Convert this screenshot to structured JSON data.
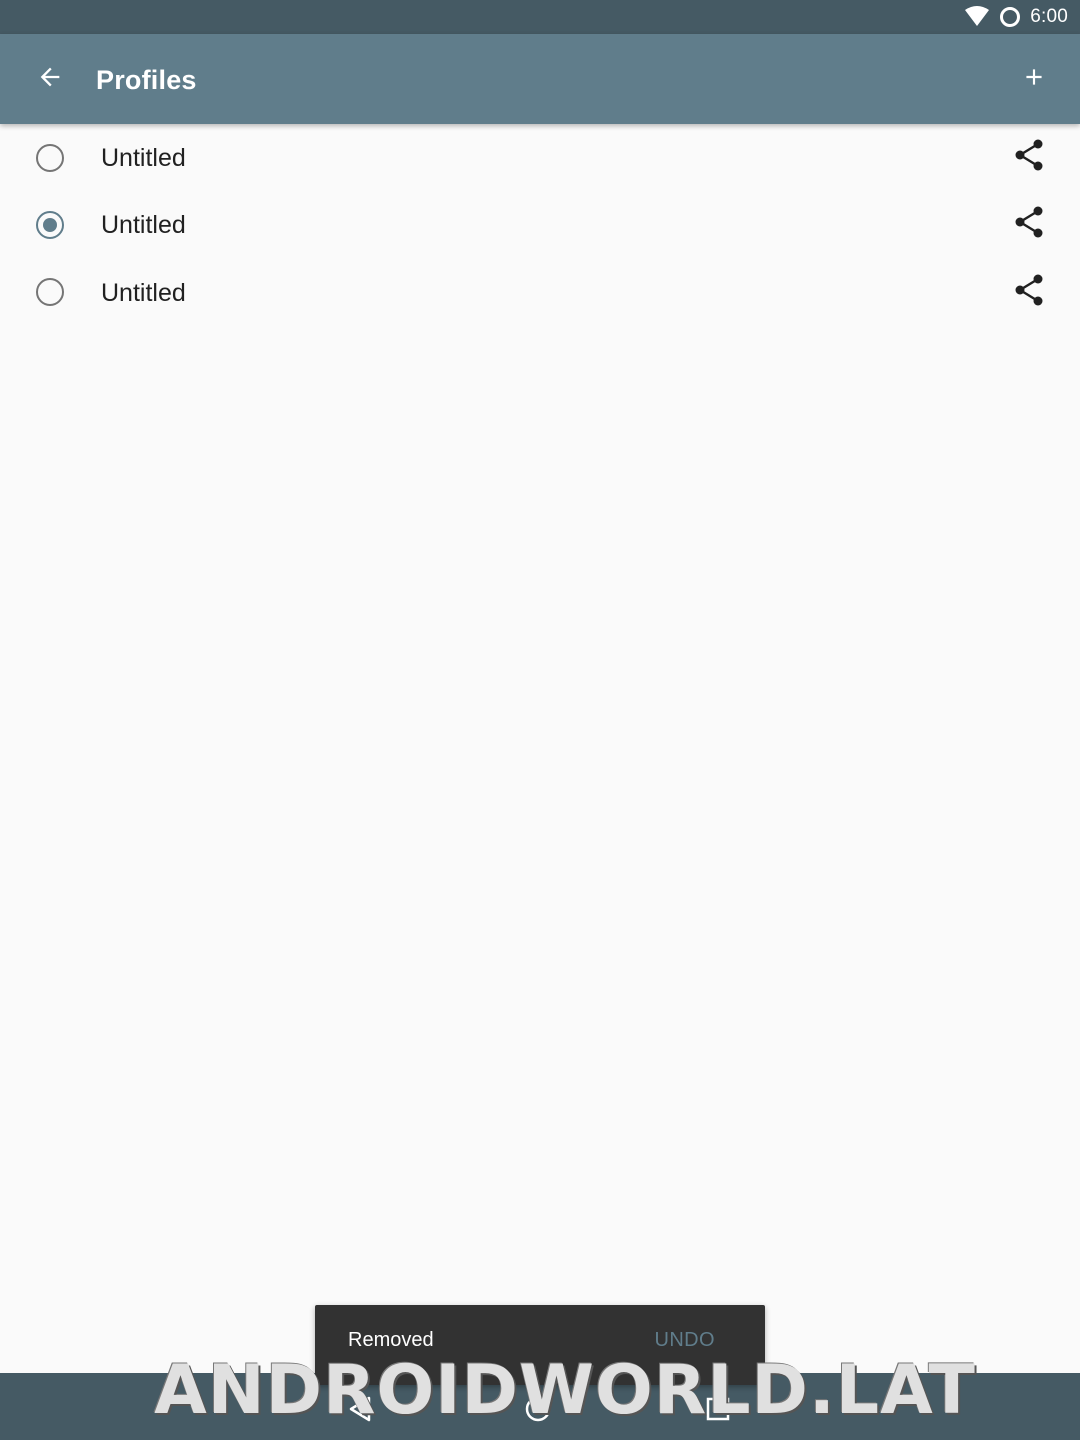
{
  "status_bar": {
    "time": "6:00",
    "icons": [
      "wifi-icon",
      "sync-circle-icon"
    ]
  },
  "app_bar": {
    "title": "Profiles",
    "back_icon": "arrow-left-icon",
    "add_icon": "plus-icon"
  },
  "profiles": [
    {
      "label": "Untitled",
      "selected": false,
      "share_icon": "share-icon"
    },
    {
      "label": "Untitled",
      "selected": true,
      "share_icon": "share-icon"
    },
    {
      "label": "Untitled",
      "selected": false,
      "share_icon": "share-icon"
    }
  ],
  "snackbar": {
    "message": "Removed",
    "action": "UNDO"
  },
  "nav_bar": {
    "icons": [
      "back-triangle-icon",
      "home-circle-icon",
      "recents-square-icon"
    ]
  },
  "watermark": {
    "text": "ANDROIDWORLD.LAT"
  },
  "colors": {
    "primary": "#607d8b",
    "primary_dark": "#455a64",
    "background": "#fafafa",
    "snackbar": "#323232"
  }
}
